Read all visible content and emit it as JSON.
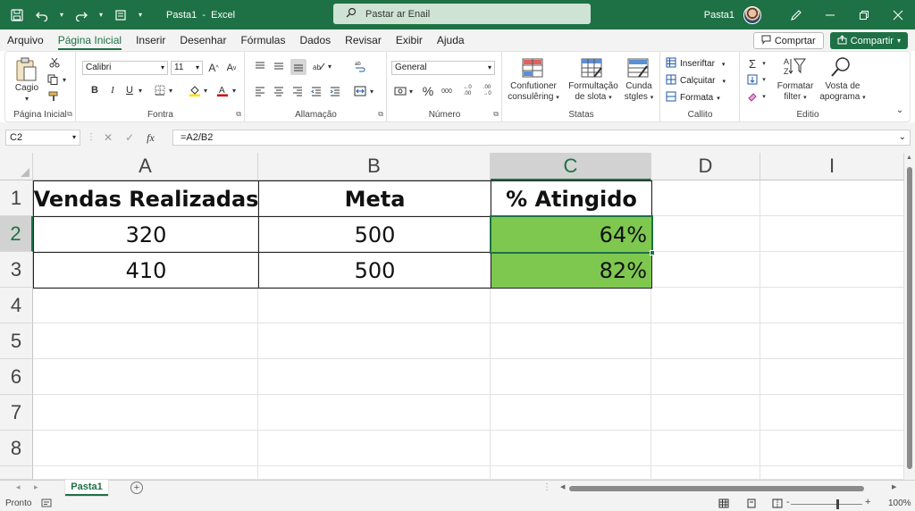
{
  "titlebar": {
    "doc_title": "Pasta1",
    "separator": "-",
    "app_name": "Excel",
    "search_placeholder": "Pastar ar Enail",
    "user_name": "Pasta1",
    "icons": [
      "save-icon",
      "undo-icon",
      "redo-icon",
      "quick-access-icon",
      "search-icon",
      "pen-icon",
      "minimize-icon",
      "restore-icon",
      "close-icon"
    ]
  },
  "menu": {
    "tabs": [
      "Arquivo",
      "Página Inicial",
      "Inserir",
      "Desenhar",
      "Fórmulas",
      "Dados",
      "Revisar",
      "Exibir",
      "Ajuda"
    ],
    "active_index": 1,
    "comment_label": "Comprtar",
    "share_label": "Compartir"
  },
  "ribbon": {
    "clipboard": {
      "paste_label": "Cagio",
      "group_label": "Página Inicial"
    },
    "font": {
      "font_name": "Calibri",
      "font_size": "11",
      "group_label": "Fontra"
    },
    "alignment": {
      "group_label": "Allamação"
    },
    "number": {
      "format": "General",
      "group_label": "Número"
    },
    "styles": {
      "conditional_label_1": "Confutioner",
      "conditional_label_2": "consulêring",
      "format_table_label_1": "Formultação",
      "format_table_label_2": "de slota",
      "cell_styles_label_1": "Cunda",
      "cell_styles_label_2": "stgles",
      "group_label": "Statas"
    },
    "cells": {
      "insert_label": "Inseriftar",
      "delete_label": "Calçuitar",
      "format_label": "Formata",
      "group_label": "Callito"
    },
    "editing": {
      "sort_label_1": "Formatar",
      "sort_label_2": "filter",
      "find_label_1": "Vosta de",
      "find_label_2": "apograma",
      "group_label": "Editio"
    }
  },
  "formula_bar": {
    "name_box": "C2",
    "cancel_symbol": "✕",
    "enter_symbol": "✓",
    "fx_symbol": "fx",
    "formula": "=A2/B2"
  },
  "sheet": {
    "columns": [
      "A",
      "B",
      "C",
      "D",
      "I"
    ],
    "rows": [
      "1",
      "2",
      "3",
      "4",
      "5",
      "6",
      "7",
      "8"
    ],
    "selected_cell": "C2",
    "cells": {
      "A1": "Vendas Realizadas",
      "B1": "Meta",
      "C1": "% Atingido",
      "A2": "320",
      "B2": "500",
      "C2": "64%",
      "A3": "410",
      "B3": "500",
      "C3": "82%"
    },
    "highlight_color": "#7ec850",
    "accent_color": "#1e7145"
  },
  "tabs": {
    "sheet_name": "Pasta1",
    "add_symbol": "+"
  },
  "status": {
    "ready_label": "Pronto",
    "zoom_label": "100%",
    "zoom_minus": "-",
    "zoom_plus": "+"
  }
}
